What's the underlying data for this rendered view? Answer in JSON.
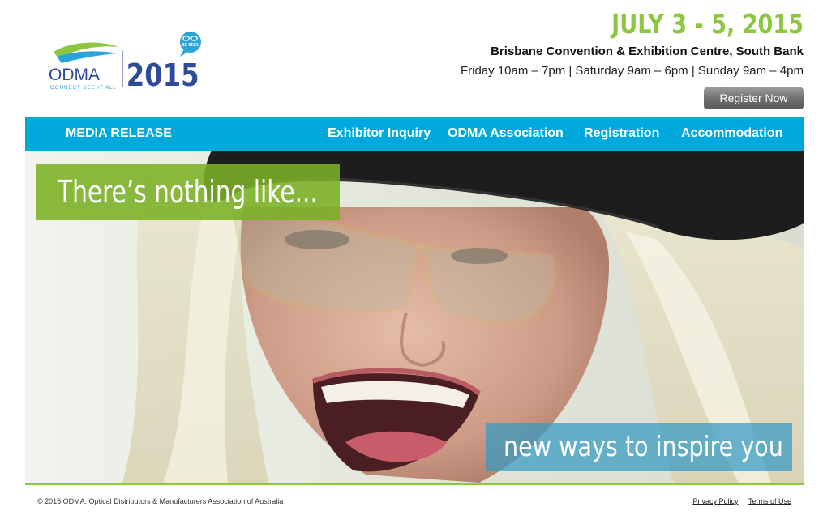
{
  "header": {
    "logo": {
      "name": "ODMA",
      "tagline": "CONNECT SEE IT ALL",
      "year": "2015",
      "badge": "BE SEEN"
    },
    "event_date": "JULY 3 - 5, 2015",
    "venue": "Brisbane Convention & Exhibition Centre, South Bank",
    "hours": "Friday 10am – 7pm | Saturday 9am – 6pm | Sunday 9am – 4pm",
    "register_label": "Register Now"
  },
  "nav": {
    "items": [
      {
        "label": "MEDIA RELEASE"
      },
      {
        "label": "Exhibitor Inquiry"
      },
      {
        "label": "ODMA Association"
      },
      {
        "label": "Registration"
      },
      {
        "label": "Accommodation"
      }
    ]
  },
  "hero": {
    "headline": "There’s nothing like...",
    "tagline": "new ways to inspire you"
  },
  "footer": {
    "copyright": "© 2015 ODMA. Optical Distributors & Manufacturers Association of Australia",
    "links": [
      {
        "label": "Privacy Policy"
      },
      {
        "label": "Terms of Use"
      }
    ]
  },
  "colors": {
    "accent_green": "#8dc63f",
    "nav_blue": "#00a9dd",
    "logo_blue": "#2e4a9a"
  }
}
